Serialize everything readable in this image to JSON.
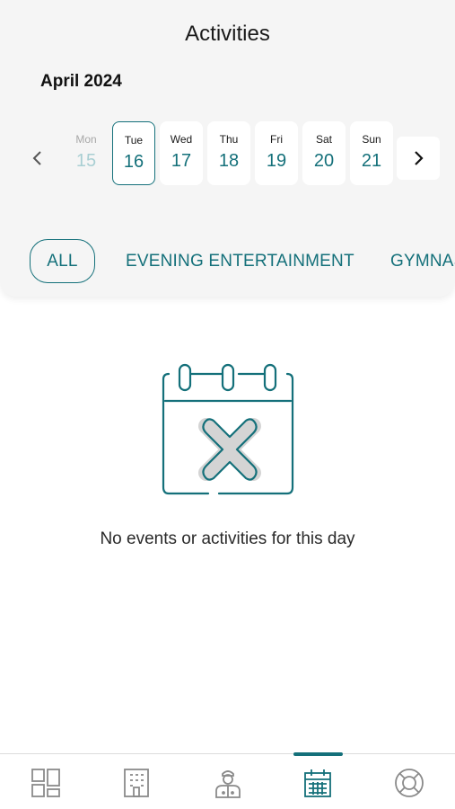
{
  "header": {
    "title": "Activities",
    "month": "April 2024"
  },
  "calendar": {
    "days": [
      {
        "weekday": "Mon",
        "date": "15",
        "state": "disabled"
      },
      {
        "weekday": "Tue",
        "date": "16",
        "state": "selected"
      },
      {
        "weekday": "Wed",
        "date": "17",
        "state": "normal"
      },
      {
        "weekday": "Thu",
        "date": "18",
        "state": "normal"
      },
      {
        "weekday": "Fri",
        "date": "19",
        "state": "normal"
      },
      {
        "weekday": "Sat",
        "date": "20",
        "state": "normal"
      },
      {
        "weekday": "Sun",
        "date": "21",
        "state": "normal"
      }
    ],
    "prev_icon": "chevron-left-icon",
    "next_icon": "chevron-right-icon"
  },
  "filters": [
    {
      "label": "ALL",
      "active": true
    },
    {
      "label": "EVENING ENTERTAINMENT",
      "active": false
    },
    {
      "label": "GYMNAS",
      "active": false
    }
  ],
  "empty_state": {
    "icon": "calendar-cancel-icon",
    "message": "No events or activities for this day"
  },
  "tab_bar": {
    "active_index": 3,
    "tabs": [
      {
        "icon": "dashboard-icon"
      },
      {
        "icon": "hotel-building-icon"
      },
      {
        "icon": "concierge-staff-icon"
      },
      {
        "icon": "calendar-icon"
      },
      {
        "icon": "lifebuoy-icon"
      }
    ]
  },
  "colors": {
    "accent": "#14707a",
    "panel_bg": "#f5f5f5",
    "icon_gray": "#8a8a8a"
  }
}
